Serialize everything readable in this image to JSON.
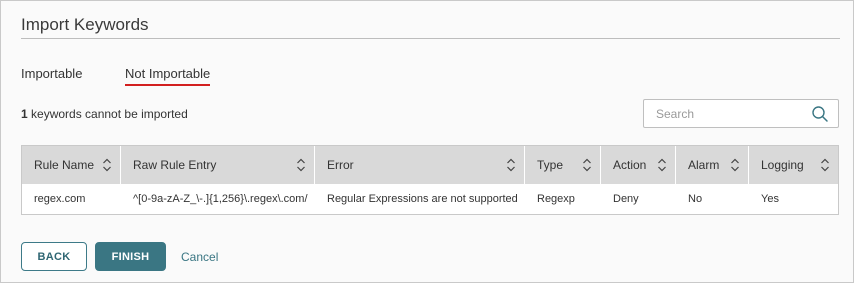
{
  "dialog": {
    "title": "Import Keywords"
  },
  "tabs": [
    {
      "label": "Importable",
      "active": false
    },
    {
      "label": "Not Importable",
      "active": true
    }
  ],
  "summary": {
    "count": "1",
    "text": " keywords cannot be imported"
  },
  "search": {
    "placeholder": "Search",
    "value": ""
  },
  "table": {
    "columns": [
      "Rule Name",
      "Raw Rule Entry",
      "Error",
      "Type",
      "Action",
      "Alarm",
      "Logging"
    ],
    "rows": [
      [
        "regex.com",
        "^[0-9a-zA-Z_\\-.]{1,256}\\.regex\\.com/",
        "Regular Expressions are not supported",
        "Regexp",
        "Deny",
        "No",
        "Yes"
      ]
    ]
  },
  "buttons": {
    "back": "BACK",
    "finish": "FINISH",
    "cancel": "Cancel"
  },
  "colors": {
    "accent": "#3a7683",
    "tab_indicator": "#d21f1f",
    "header_bg": "#d9d9d9"
  },
  "icons": {
    "search": "search-icon",
    "sort": "sort-icon"
  }
}
